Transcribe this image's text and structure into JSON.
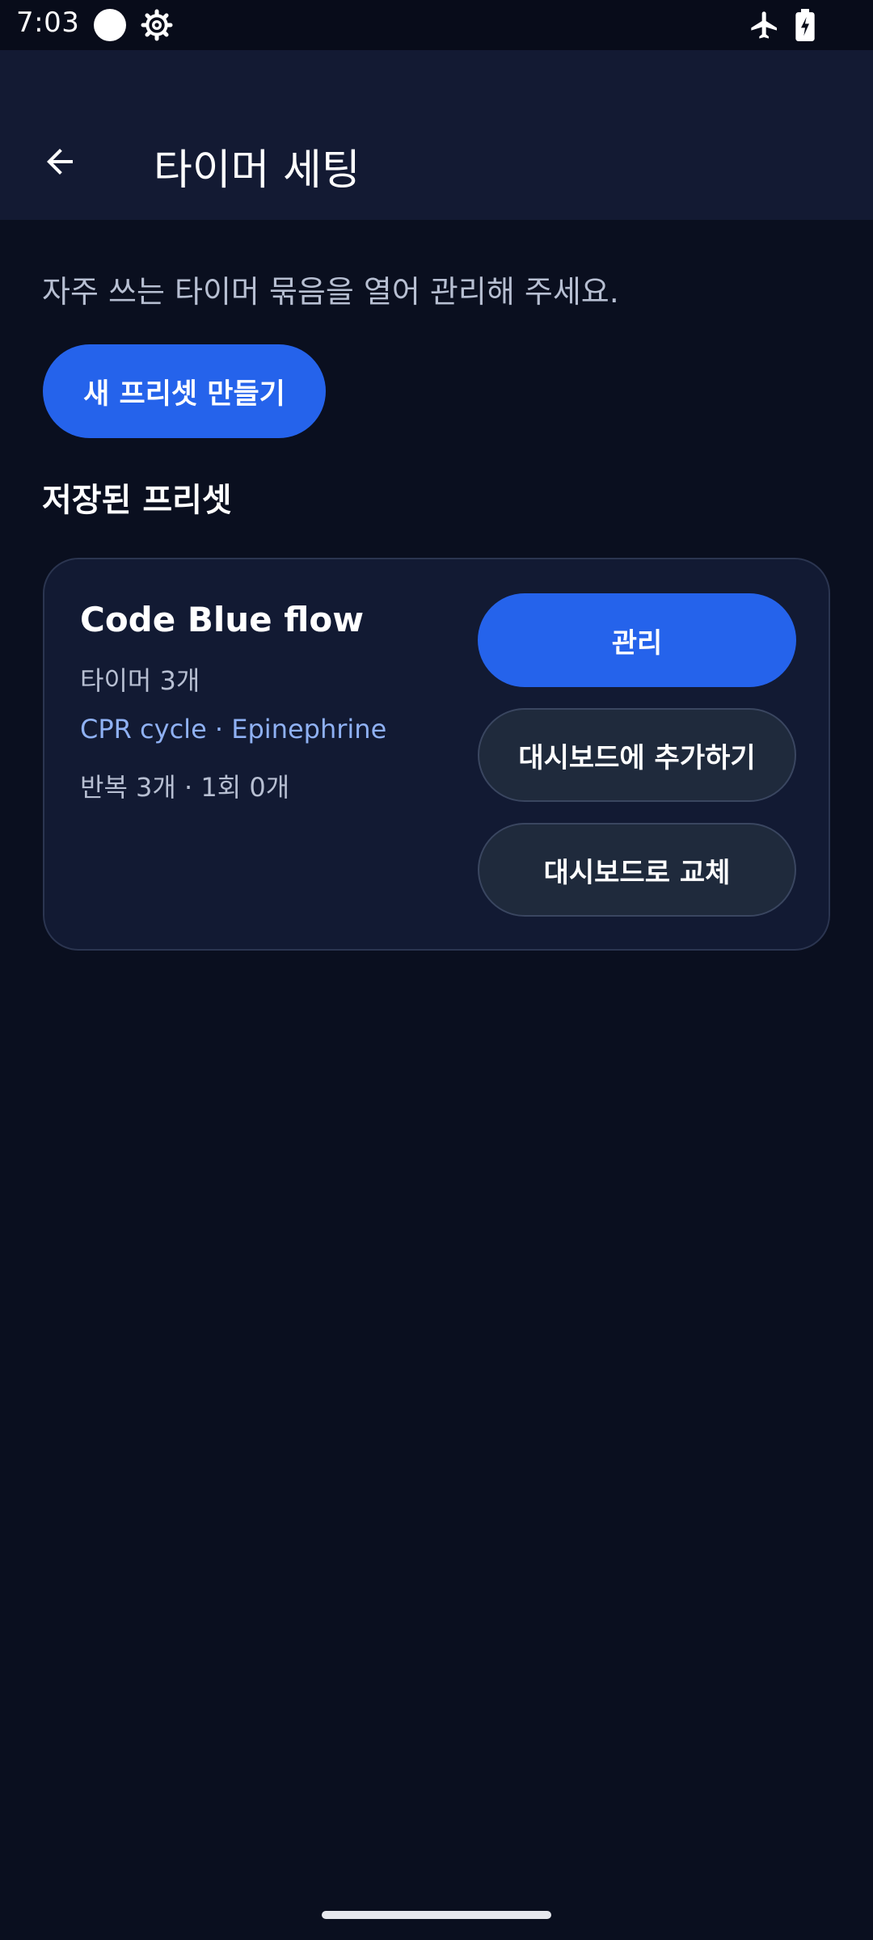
{
  "status_bar": {
    "time": "7:03",
    "icons": [
      "circle-icon",
      "gear-icon",
      "airplane-icon",
      "battery-charging-icon"
    ]
  },
  "app_bar": {
    "title": "타이머 세팅",
    "back_icon": "arrow-left-icon"
  },
  "main": {
    "subtitle": "자주 쓰는 타이머 묶음을 열어 관리해 주세요.",
    "new_preset_label": "새 프리셋 만들기",
    "section_heading": "저장된 프리셋",
    "presets": [
      {
        "title": "Code Blue flow",
        "count": "타이머 3개",
        "timers": "CPR cycle · Epinephrine",
        "detail": "반복 3개 · 1회 0개",
        "manage_label": "관리",
        "add_label": "대시보드에 추가하기",
        "replace_label": "대시보드로 교체"
      }
    ]
  },
  "colors": {
    "background": "#0a0f1f",
    "app_bar": "#131a33",
    "accent": "#2563eb",
    "card": "#121a33",
    "secondary_button": "#1f2a3c",
    "link_text": "#8fb1f4"
  }
}
